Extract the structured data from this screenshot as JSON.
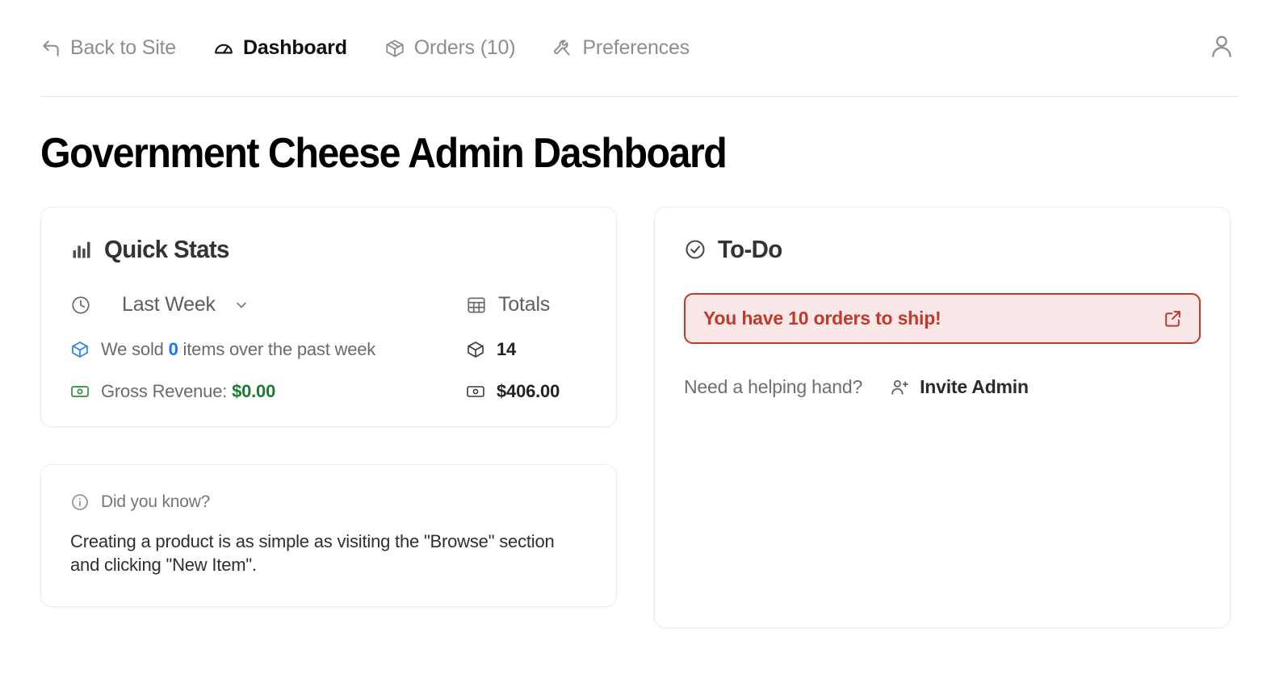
{
  "nav": {
    "items": [
      {
        "label": "Back to Site",
        "icon": "back-arrow-icon",
        "active": false
      },
      {
        "label": "Dashboard",
        "icon": "gauge-icon",
        "active": true
      },
      {
        "label": "Orders (10)",
        "icon": "package-icon",
        "active": false
      },
      {
        "label": "Preferences",
        "icon": "wrench-icon",
        "active": false
      }
    ],
    "account_icon": "user-icon"
  },
  "page": {
    "title": "Government Cheese Admin Dashboard"
  },
  "quick_stats": {
    "icon": "bar-chart-icon",
    "title": "Quick Stats",
    "period_selector": {
      "icon": "clock-icon",
      "label": "Last Week",
      "chevron": "chevron-down-icon"
    },
    "totals_header": {
      "icon": "table-icon",
      "label": "Totals"
    },
    "rows": [
      {
        "icon": "box-3d-icon",
        "text_before": "We sold ",
        "value": "0",
        "text_after": " items over the past week",
        "total_icon": "box-outline-icon",
        "total": "14"
      },
      {
        "icon": "banknote-icon",
        "text_before": "Gross Revenue: ",
        "value": "$0.00",
        "text_after": "",
        "total_icon": "banknote-outline-icon",
        "total": "$406.00"
      }
    ]
  },
  "todo": {
    "icon": "check-circle-icon",
    "title": "To-Do",
    "alert": {
      "text": "You have 10 orders to ship!",
      "icon": "external-link-icon"
    },
    "helper_text": "Need a helping hand?",
    "invite": {
      "icon": "user-plus-icon",
      "label": "Invite Admin"
    }
  },
  "tip": {
    "icon": "info-icon",
    "label": "Did you know?",
    "body": "Creating a product is as simple as visiting the \"Browse\" section and clicking \"New Item\"."
  },
  "colors": {
    "accent_blue": "#1877f2",
    "accent_green": "#1f7a34",
    "alert_red": "#c0392b",
    "alert_bg": "#fae7e7",
    "border": "#ececec"
  }
}
